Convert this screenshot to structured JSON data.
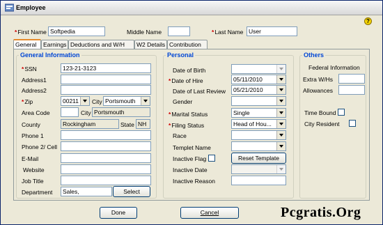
{
  "window": {
    "title": "Employee"
  },
  "header": {
    "first_name_label": "First Name",
    "first_name_value": "Softpedia",
    "middle_name_label": "Middle Name",
    "middle_name_value": "",
    "last_name_label": "Last Name",
    "last_name_value": "User",
    "help_glyph": "?"
  },
  "tabs": [
    "General",
    "Earnings",
    "Deductions and W/H",
    "W2 Details",
    "Contribution"
  ],
  "general": {
    "title": "General Information",
    "ssn_label": "SSN",
    "ssn_value": "123-21-3123",
    "address1_label": "Address1",
    "address1_value": "",
    "address2_label": "Address2",
    "address2_value": "",
    "zip_label": "Zip",
    "zip_value": "00211",
    "city_label": "City",
    "city_value": "Portsmouth",
    "area_code_label": "Area Code",
    "area_code_value": "",
    "city2_label": "City",
    "city2_value": "Portsmouth",
    "county_label": "County",
    "county_value": "Rockingham",
    "state_label": "State",
    "state_value": "NH",
    "phone1_label": "Phone 1",
    "phone1_value": "",
    "phone2_label": "Phone 2/ Cell",
    "phone2_value": "",
    "email_label": "E-Mail",
    "email_value": "",
    "website_label": "Website",
    "website_value": "",
    "job_title_label": "Job Title",
    "job_title_value": "",
    "department_label": "Department",
    "department_value": "Sales,",
    "select_button": "Select"
  },
  "personal": {
    "title": "Personal",
    "dob_label": "Date of Birth",
    "dob_value": "",
    "doh_label": "Date of Hire",
    "doh_value": "05/11/2010",
    "dlr_label": "Date of Last Review",
    "dlr_value": "05/21/2010",
    "gender_label": "Gender",
    "gender_value": "",
    "marital_label": "Marital Status",
    "marital_value": "Single",
    "filing_label": "Filing Status",
    "filing_value": "Head of Hou...",
    "race_label": "Race",
    "race_value": "",
    "template_label": "Templet Name",
    "template_value": "",
    "inactive_flag_label": "Inactive Flag",
    "reset_template_button": "Reset Template",
    "inactive_date_label": "Inactive Date",
    "inactive_date_value": "",
    "inactive_reason_label": "Inactive Reason",
    "inactive_reason_value": ""
  },
  "others": {
    "title": "Others",
    "federal_label": "Federal Information",
    "extra_wh_label": "Extra W/Hs",
    "extra_wh_value": "",
    "allowances_label": "Allowances",
    "allowances_value": "",
    "time_bound_label": "Time Bound",
    "city_resident_label": "City Resident"
  },
  "footer": {
    "done_button": "Done",
    "cancel_button": "Cancel"
  },
  "watermark": "Pcgratis.Org"
}
